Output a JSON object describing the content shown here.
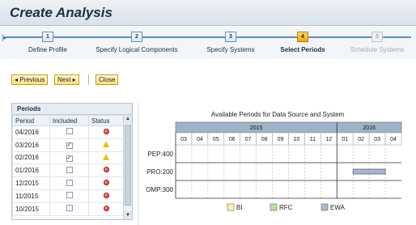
{
  "window": {
    "title": "Create Analysis"
  },
  "roadmap": {
    "steps": [
      {
        "num": "1",
        "label": "Define Profile",
        "state": "done"
      },
      {
        "num": "2",
        "label": "Specify Logical Components",
        "state": "done"
      },
      {
        "num": "3",
        "label": "Specify Systems",
        "state": "done"
      },
      {
        "num": "4",
        "label": "Select Periods",
        "state": "active"
      },
      {
        "num": "5",
        "label": "Schedule Systems",
        "state": "disabled"
      }
    ]
  },
  "toolbar": {
    "previous_label": "◂ Previous",
    "next_label": "Next ▸",
    "close_label": "Close"
  },
  "periods_table": {
    "caption": "Periods",
    "columns": [
      "Period",
      "Included",
      "Status"
    ],
    "rows": [
      {
        "period": "04/2016",
        "included": false,
        "status": "red"
      },
      {
        "period": "03/2016",
        "included": true,
        "status": "yellow"
      },
      {
        "period": "02/2016",
        "included": true,
        "status": "yellow"
      },
      {
        "period": "01/2016",
        "included": false,
        "status": "red"
      },
      {
        "period": "12/2015",
        "included": false,
        "status": "red"
      },
      {
        "period": "11/2015",
        "included": false,
        "status": "red"
      },
      {
        "period": "10/2015",
        "included": false,
        "status": "red"
      }
    ]
  },
  "chart_data": {
    "type": "gantt",
    "title": "Available Periods for Data Source and System",
    "years": [
      {
        "label": "2015",
        "months": [
          "03",
          "04",
          "05",
          "06",
          "07",
          "08",
          "09",
          "10",
          "11",
          "12"
        ]
      },
      {
        "label": "2016",
        "months": [
          "01",
          "02",
          "03",
          "04"
        ]
      }
    ],
    "systems": [
      "PEP:400",
      "PRO:200",
      "OMP:300"
    ],
    "bars": [
      {
        "system": "PRO:200",
        "source": "EWA",
        "start": "02/2016",
        "end": "03/2016"
      }
    ],
    "legend": [
      {
        "name": "BI",
        "color": "#fff3a8"
      },
      {
        "name": "RFC",
        "color": "#b7e1a1"
      },
      {
        "name": "EWA",
        "color": "#a9b8cc"
      }
    ]
  },
  "colors": {
    "accent": "#f0a800",
    "header_bg": "#9fb3c8",
    "status_red": "#d4271a",
    "status_yellow": "#e8c400"
  }
}
